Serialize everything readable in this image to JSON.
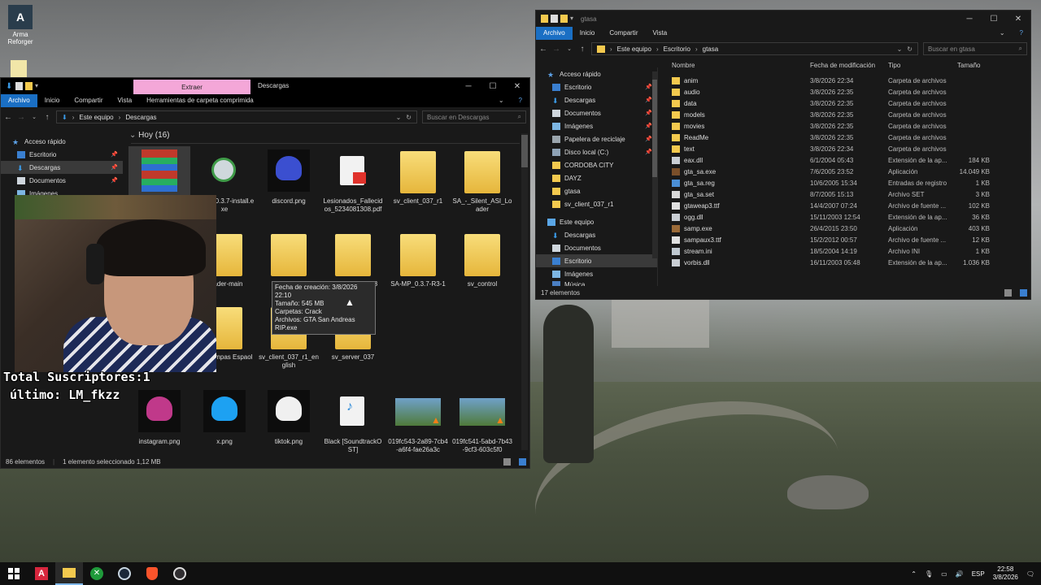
{
  "desktop": {
    "icons": [
      {
        "label": "Arma Reforger"
      }
    ]
  },
  "downloads_window": {
    "ribbon_contextual": "Extraer",
    "title": "Descargas",
    "tabs": [
      "Archivo",
      "Inicio",
      "Compartir",
      "Vista",
      "Herramientas de carpeta comprimida"
    ],
    "breadcrumb": [
      "Este equipo",
      "Descargas"
    ],
    "search_placeholder": "Buscar en Descargas",
    "group_header": "Hoy (16)",
    "nav": [
      {
        "label": "Acceso rápido"
      },
      {
        "label": "Escritorio"
      },
      {
        "label": "Descargas"
      },
      {
        "label": "Documentos"
      },
      {
        "label": "Imágenes"
      }
    ],
    "items": [
      {
        "name": "",
        "type": "winrar"
      },
      {
        "name": "sa-mp-0.3.7-install.exe",
        "type": "installer"
      },
      {
        "name": "discord.png",
        "type": "helmet-blue"
      },
      {
        "name": "Lesionados_Fallecidos_5234081308.pdf",
        "type": "pdf"
      },
      {
        "name": "sv_client_037_r1",
        "type": "folder"
      },
      {
        "name": "SA_-_Silent_ASI_Loader",
        "type": "folder"
      },
      {
        "name": "Loader-main",
        "type": "folder"
      },
      {
        "name": "GTA SA",
        "type": "folder"
      },
      {
        "name": "sv_client_037_r3",
        "type": "folder"
      },
      {
        "name": "SA-MP_0.3.7-R3-1",
        "type": "folder"
      },
      {
        "name": "sv_control",
        "type": "folder"
      },
      {
        "name": "de_trampas Espaol",
        "type": "folder"
      },
      {
        "name": "sv_client_037_r1_english",
        "type": "folder"
      },
      {
        "name": "sv_server_037",
        "type": "folder"
      },
      {
        "name": "instagram.png",
        "type": "helmet-pink"
      },
      {
        "name": "x.png",
        "type": "helmet-cyan"
      },
      {
        "name": "tiktok.png",
        "type": "helmet-white"
      },
      {
        "name": "Black [SoundtrackOST]",
        "type": "mp3"
      },
      {
        "name": "019fc543-2a89-7cb4-a6f4-fae26a3c",
        "type": "video"
      },
      {
        "name": "019fc541-5abd-7b43-9cf3-603c5f0",
        "type": "video"
      }
    ],
    "status": {
      "count": "86 elementos",
      "selected": "1 elemento seleccionado  1,12 MB"
    }
  },
  "tooltip": {
    "lines": [
      "Fecha de creación: 3/8/2026 22:10",
      "Tamaño: 545 MB",
      "Carpetas: Crack",
      "Archivos: GTA San Andreas RIP.exe"
    ]
  },
  "gtasa_window": {
    "title": "gtasa",
    "tabs": [
      "Archivo",
      "Inicio",
      "Compartir",
      "Vista"
    ],
    "breadcrumb": [
      "Este equipo",
      "Escritorio",
      "gtasa"
    ],
    "search_placeholder": "Buscar en gtasa",
    "columns": [
      "Nombre",
      "Fecha de modificación",
      "Tipo",
      "Tamaño"
    ],
    "nav": [
      {
        "label": "Acceso rápido",
        "pin": false
      },
      {
        "label": "Escritorio",
        "pin": true
      },
      {
        "label": "Descargas",
        "pin": true
      },
      {
        "label": "Documentos",
        "pin": true
      },
      {
        "label": "Imágenes",
        "pin": true
      },
      {
        "label": "Papelera de reciclaje",
        "pin": true
      },
      {
        "label": "Disco local (C:)",
        "pin": true
      },
      {
        "label": "CORDOBA CITY",
        "pin": false
      },
      {
        "label": "DAYZ",
        "pin": false
      },
      {
        "label": "gtasa",
        "pin": false
      },
      {
        "label": "sv_client_037_r1",
        "pin": false
      },
      {
        "label": "Este equipo",
        "pin": false
      },
      {
        "label": "Descargas",
        "pin": false
      },
      {
        "label": "Documentos",
        "pin": false
      },
      {
        "label": "Escritorio",
        "pin": false
      },
      {
        "label": "Imágenes",
        "pin": false
      },
      {
        "label": "Música",
        "pin": false
      }
    ],
    "files": [
      {
        "name": "anim",
        "date": "3/8/2026 22:34",
        "type": "Carpeta de archivos",
        "size": "",
        "icon": "folder"
      },
      {
        "name": "audio",
        "date": "3/8/2026 22:35",
        "type": "Carpeta de archivos",
        "size": "",
        "icon": "folder"
      },
      {
        "name": "data",
        "date": "3/8/2026 22:35",
        "type": "Carpeta de archivos",
        "size": "",
        "icon": "folder"
      },
      {
        "name": "models",
        "date": "3/8/2026 22:35",
        "type": "Carpeta de archivos",
        "size": "",
        "icon": "folder"
      },
      {
        "name": "movies",
        "date": "3/8/2026 22:35",
        "type": "Carpeta de archivos",
        "size": "",
        "icon": "folder"
      },
      {
        "name": "ReadMe",
        "date": "3/8/2026 22:35",
        "type": "Carpeta de archivos",
        "size": "",
        "icon": "folder"
      },
      {
        "name": "text",
        "date": "3/8/2026 22:34",
        "type": "Carpeta de archivos",
        "size": "",
        "icon": "folder"
      },
      {
        "name": "eax.dll",
        "date": "6/1/2004 05:43",
        "type": "Extensión de la ap...",
        "size": "184 KB",
        "icon": "dll"
      },
      {
        "name": "gta_sa.exe",
        "date": "7/6/2005 23:52",
        "type": "Aplicación",
        "size": "14.049 KB",
        "icon": "exe"
      },
      {
        "name": "gta_sa.reg",
        "date": "10/6/2005 15:34",
        "type": "Entradas de registro",
        "size": "1 KB",
        "icon": "reg"
      },
      {
        "name": "gta_sa.set",
        "date": "8/7/2005 15:13",
        "type": "Archivo SET",
        "size": "3 KB",
        "icon": "file"
      },
      {
        "name": "gtaweap3.ttf",
        "date": "14/4/2007 07:24",
        "type": "Archivo de fuente ...",
        "size": "102 KB",
        "icon": "ttf"
      },
      {
        "name": "ogg.dll",
        "date": "15/11/2003 12:54",
        "type": "Extensión de la ap...",
        "size": "36 KB",
        "icon": "dll"
      },
      {
        "name": "samp.exe",
        "date": "26/4/2015 23:50",
        "type": "Aplicación",
        "size": "403 KB",
        "icon": "exe2"
      },
      {
        "name": "sampaux3.ttf",
        "date": "15/2/2012 00:57",
        "type": "Archivo de fuente ...",
        "size": "12 KB",
        "icon": "ttf"
      },
      {
        "name": "stream.ini",
        "date": "18/5/2004 14:19",
        "type": "Archivo INI",
        "size": "1 KB",
        "icon": "ini"
      },
      {
        "name": "vorbis.dll",
        "date": "16/11/2003 05:48",
        "type": "Extensión de la ap...",
        "size": "1.036 KB",
        "icon": "dll"
      }
    ],
    "status": "17 elementos"
  },
  "webcam": {
    "overlay_line1": "Total Suscriptores:1",
    "overlay_line2": "último: LM_fkzz"
  },
  "taskbar": {
    "apps": [
      "windows-icon",
      "search-icon",
      "task-view-icon",
      "arma-icon",
      "file-explorer-icon",
      "xbox-icon",
      "steam-icon",
      "brave-icon",
      "obs-icon"
    ],
    "lang": "ESP",
    "time": "22:58",
    "date": "3/8/2026"
  }
}
